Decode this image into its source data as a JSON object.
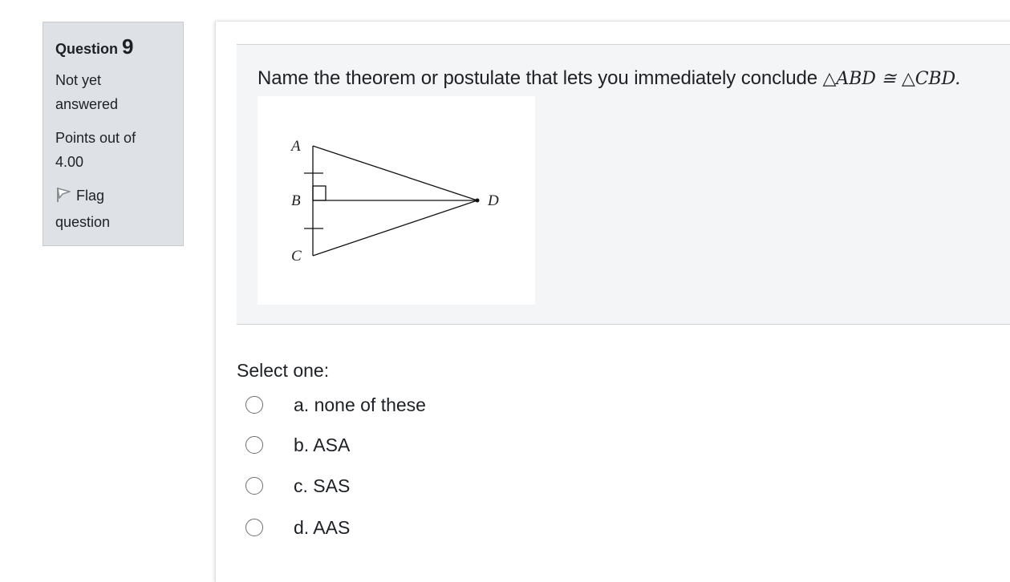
{
  "info": {
    "question_label": "Question",
    "question_number": "9",
    "state": "Not yet answered",
    "grade": "Points out of 4.00",
    "flag_label": "Flag question"
  },
  "question": {
    "text": "Name the theorem or postulate that lets you immediately conclude",
    "math": "△ABD ≅ △CBD.",
    "figure_labels": {
      "a": "A",
      "b": "B",
      "c": "C",
      "d": "D"
    }
  },
  "prompt": "Select one:",
  "answers": [
    {
      "label": "a. none of these",
      "selected": false
    },
    {
      "label": "b. ASA",
      "selected": false
    },
    {
      "label": "c. SAS",
      "selected": false
    },
    {
      "label": "d. AAS",
      "selected": false
    }
  ]
}
